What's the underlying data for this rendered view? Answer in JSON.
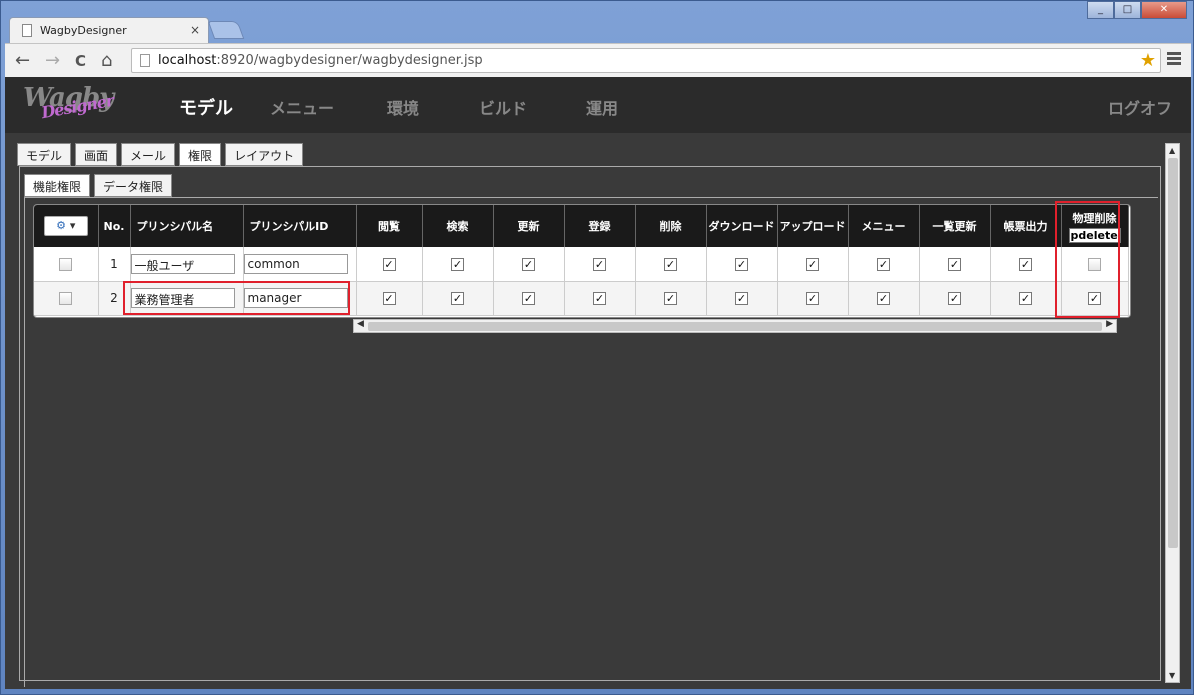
{
  "browser": {
    "tab_title": "WagbyDesigner",
    "tab_close": "×",
    "url_host": "localhost",
    "url_rest": ":8920/wagbydesigner/wagbydesigner.jsp",
    "win_min": "_",
    "win_max": "□",
    "win_close": "✕",
    "back": "←",
    "forward": "→",
    "reload": "C",
    "home": "⌂",
    "star": "★"
  },
  "app": {
    "logo_main": "Wagby",
    "logo_sub": "Designer",
    "nav": [
      "モデル",
      "メニュー",
      "環境",
      "ビルド",
      "運用"
    ],
    "logout": "ログオフ"
  },
  "subtabs": [
    "モデル",
    "画面",
    "メール",
    "権限",
    "レイアウト"
  ],
  "subtabs2": [
    "機能権限",
    "データ権限"
  ],
  "grid": {
    "gear_label": "▾",
    "gear_icon": "⚙",
    "headers": [
      "No.",
      "プリンシパル名",
      "プリンシパルID",
      "閲覧",
      "検索",
      "更新",
      "登録",
      "削除",
      "ダウンロード",
      "アップロード",
      "メニュー",
      "一覧更新",
      "帳票出力"
    ],
    "last_header": "物理削除",
    "last_header_id": "pdelete",
    "rows": [
      {
        "no": "1",
        "name": "一般ユーザ",
        "id": "common",
        "perms": [
          true,
          true,
          true,
          true,
          true,
          true,
          true,
          true,
          true,
          true,
          false
        ]
      },
      {
        "no": "2",
        "name": "業務管理者",
        "id": "manager",
        "perms": [
          true,
          true,
          true,
          true,
          true,
          true,
          true,
          true,
          true,
          true,
          true
        ]
      }
    ]
  }
}
